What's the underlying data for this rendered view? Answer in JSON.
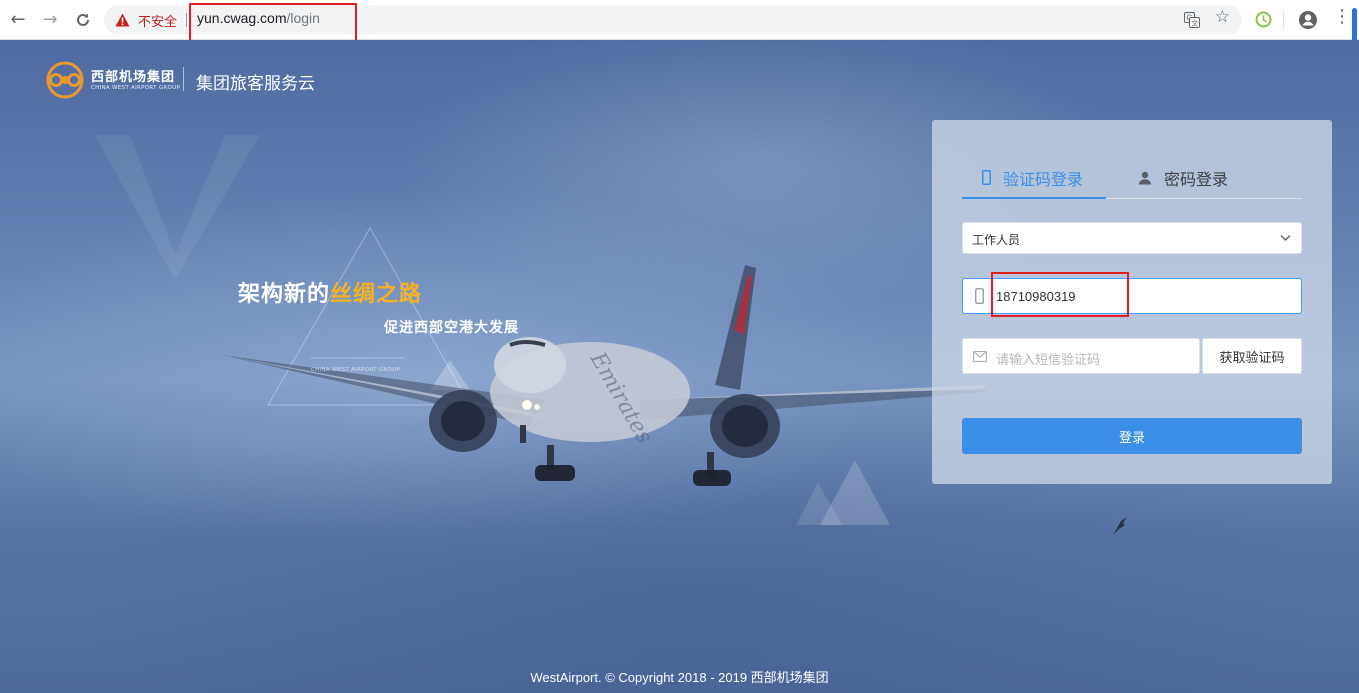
{
  "browser": {
    "security_label": "不安全",
    "url_host": "yun.cwag.com",
    "url_path": "/login",
    "icons": [
      "back-icon",
      "forward-icon",
      "reload-icon",
      "warning-icon",
      "translate-icon",
      "star-icon",
      "extension-icon",
      "profile-icon",
      "menu-icon"
    ]
  },
  "header": {
    "brand_cn": "西部机场集团",
    "brand_en": "CHINA WEST AIRPORT GROUP",
    "title": "集团旅客服务云"
  },
  "slogan": {
    "main_prefix": "架构新的",
    "main_highlight": "丝绸之路",
    "sub": "促进西部空港大发展",
    "tag": "CHINA WEST AIRPORT GROUP"
  },
  "login": {
    "tabs": [
      {
        "label": "验证码登录",
        "icon": "mobile-icon",
        "active": true
      },
      {
        "label": "密码登录",
        "icon": "user-icon",
        "active": false
      }
    ],
    "role_value": "工作人员",
    "phone_value": "18710980319",
    "code_placeholder": "请输入短信验证码",
    "get_code_label": "获取验证码",
    "submit_label": "登录"
  },
  "footer": {
    "text": "WestAirport. © Copyright 2018 - 2019 西部机场集团"
  },
  "colors": {
    "accent": "#3a8ee6",
    "highlight": "#f5b324",
    "annotation": "#e02020",
    "insecure": "#c5221f"
  }
}
